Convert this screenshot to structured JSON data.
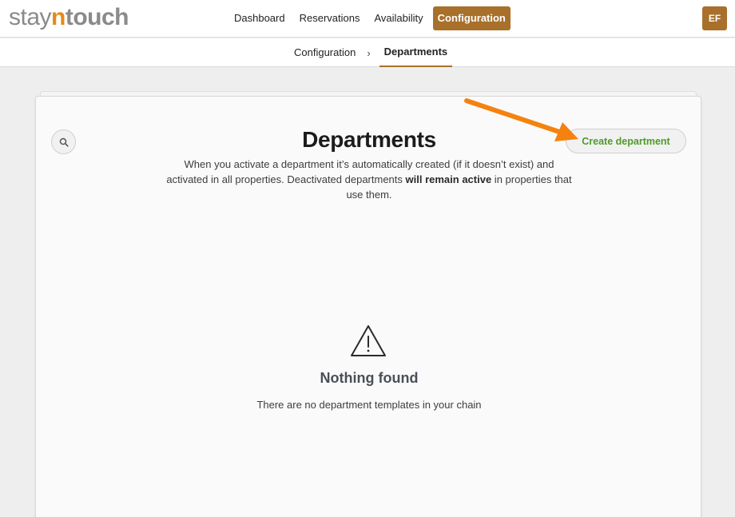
{
  "header": {
    "logo": {
      "part1": "stay",
      "part2": "n",
      "part3": "touch"
    },
    "nav": [
      {
        "label": "Dashboard"
      },
      {
        "label": "Reservations"
      },
      {
        "label": "Availability"
      },
      {
        "label": "Configuration",
        "active": true
      }
    ],
    "user_initials": "EF"
  },
  "breadcrumb": {
    "parent": "Configuration",
    "separator": "›",
    "current": "Departments"
  },
  "main": {
    "title": "Departments",
    "description_pre": "When you activate a department it’s automatically created (if it doesn’t exist) and activated in all properties. Deactivated departments ",
    "description_bold": "will remain active",
    "description_post": " in properties that use them.",
    "create_button_label": "Create department",
    "search_icon": "search-icon",
    "empty_state": {
      "icon": "warning-icon",
      "title": "Nothing found",
      "message": "There are no department templates in your chain"
    }
  },
  "colors": {
    "brand": "#a8702a",
    "logo_accent": "#e58a17",
    "create_text": "#4f9a2a",
    "annotation_arrow": "#f5820f"
  }
}
